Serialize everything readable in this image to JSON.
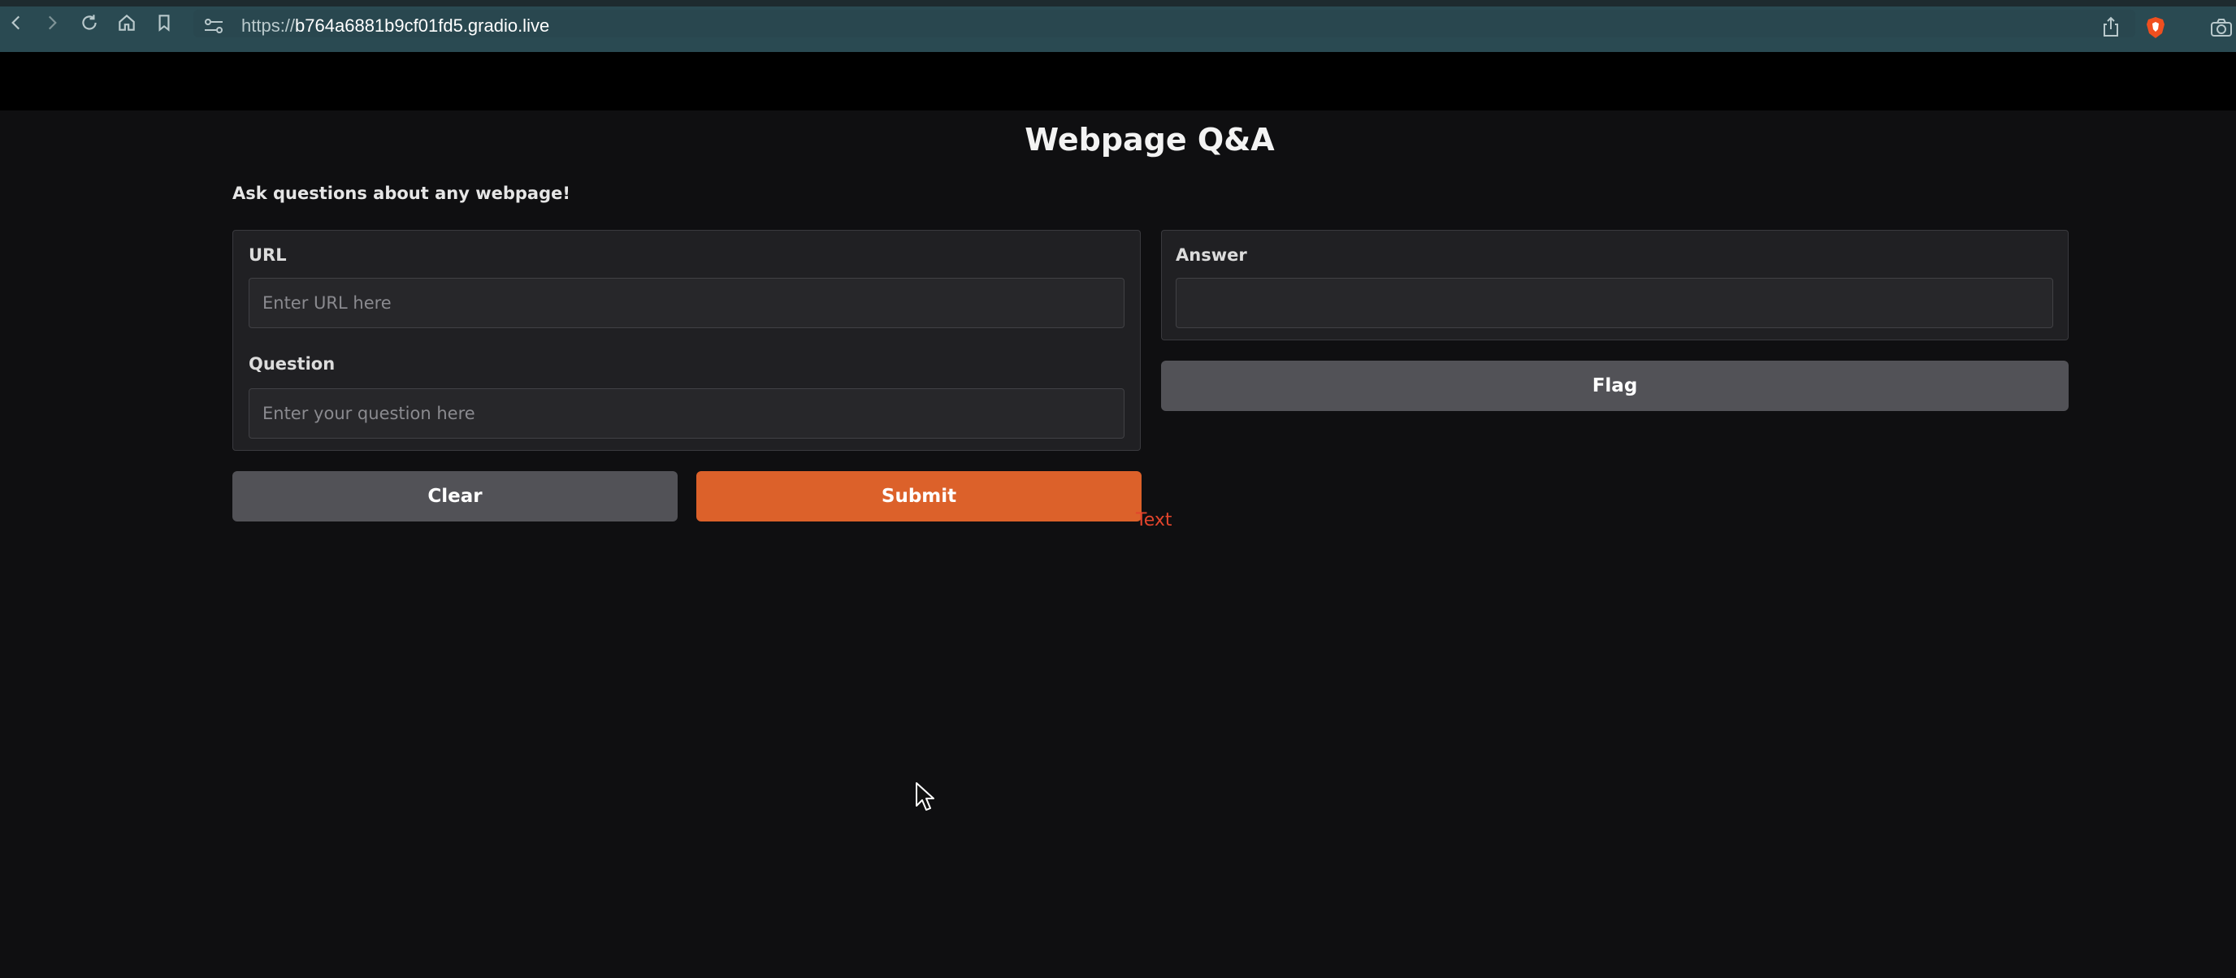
{
  "browser": {
    "url_prefix": "https://",
    "url_host": "b764a6881b9cf01fd5.gradio.live",
    "icons": {
      "back": "chevron-left-icon",
      "forward": "chevron-right-icon",
      "reload": "reload-icon",
      "home": "home-icon",
      "bookmark": "bookmark-icon",
      "site_settings": "site-settings-icon",
      "share": "share-icon",
      "brave": "brave-shield-icon",
      "camera": "camera-icon"
    }
  },
  "app": {
    "title": "Webpage Q&A",
    "description": "Ask questions about any webpage!",
    "inputs": {
      "url_label": "URL",
      "url_placeholder": "Enter URL here",
      "url_value": "",
      "question_label": "Question",
      "question_placeholder": "Enter your question here",
      "question_value": ""
    },
    "outputs": {
      "answer_label": "Answer",
      "answer_value": ""
    },
    "buttons": {
      "clear": "Clear",
      "submit": "Submit",
      "flag": "Flag"
    },
    "stray_label": "Text"
  },
  "colors": {
    "background": "#0f0f11",
    "panel": "#202023",
    "primary_button": "#dc612a",
    "secondary_button": "#525257",
    "browser_bar": "#2a4a52"
  }
}
